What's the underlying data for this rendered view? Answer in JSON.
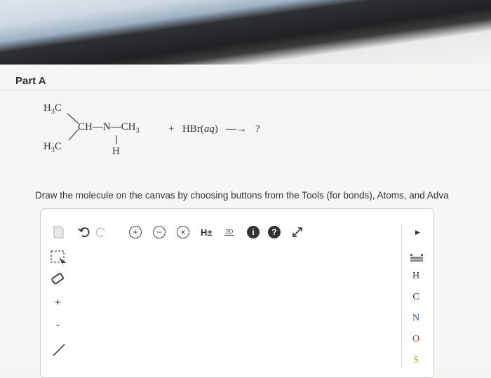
{
  "header": {
    "part_label": "Part A"
  },
  "reaction": {
    "left_top": "H",
    "left_top_sub": "3",
    "left_top_c": "C",
    "left_bot": "H",
    "left_bot_sub": "3",
    "left_bot_c": "C",
    "main_chain": "CH—N—CH",
    "main_chain_sub": "3",
    "plus": "+",
    "reagent": "HBr(",
    "reagent_state": "aq",
    "reagent_close": ")",
    "arrow": "—→",
    "product": "?",
    "n_h": "H"
  },
  "instruction": "Draw the molecule on the canvas by choosing buttons from the Tools (for bonds), Atoms, and Adva",
  "toolbar": {
    "explicit_h_label": "H±",
    "twod_label": "2D",
    "info_label": "i",
    "help_label": "?"
  },
  "atoms": {
    "items": [
      "H",
      "C",
      "N",
      "O",
      "S"
    ],
    "colors": [
      "#333333",
      "#333333",
      "#3050c8",
      "#d23a2a",
      "#b8a020"
    ]
  },
  "leftbar": {
    "plus_label": "+",
    "minus_label": "-"
  }
}
